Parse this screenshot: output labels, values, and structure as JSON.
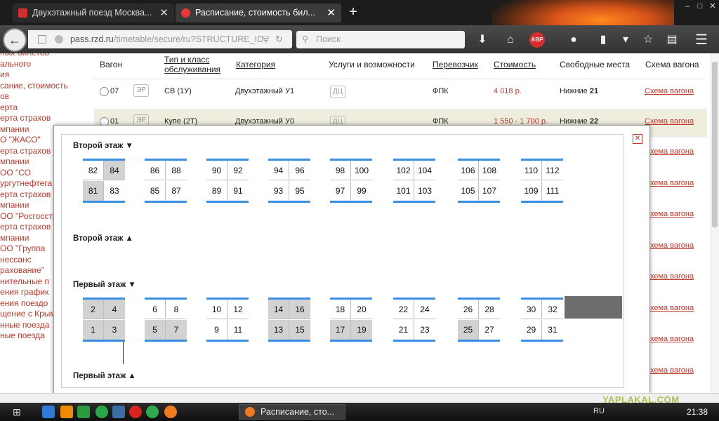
{
  "tabs": [
    {
      "title": "Двухэтажный поезд Москва...",
      "close": "✕"
    },
    {
      "title": "Расписание, стоимость бил...",
      "close": "✕"
    }
  ],
  "new_tab": "+",
  "window": {
    "minimize": "–",
    "maximize": "□",
    "close": "✕"
  },
  "nav": {
    "url_host": "pass.rzd.ru",
    "url_path": "/timetable/secure/ru?STRUCTURE_ID=",
    "search_placeholder": "Поиск",
    "back": "←"
  },
  "left_links": [
    "ных билетов",
    "ального",
    "ия",
    "сание, стоимость",
    "ов",
    "ерта",
    "ерта страхов",
    "мпании",
    "О \"ЖАСО\"",
    "ерта страхов",
    "мпании",
    "ОО \"СО",
    "ургутнефтега",
    "ерта страхов",
    "мпании",
    "ОО \"Росгосстр",
    "ерта страхов",
    "мпании",
    "ОО \"Группа",
    "нессанс",
    "рахование\"",
    "нительные п",
    "ения график",
    "ения поездо",
    "щение с Крым",
    "нные поезда",
    "ные поезда"
  ],
  "table": {
    "headers": {
      "wagon": "Вагон",
      "type": "Тип и класс обслуживания",
      "category": "Категория",
      "services": "Услуги и возможности",
      "carrier": "Перевозчик",
      "cost": "Стоимость",
      "free": "Свободные места",
      "scheme": "Схема вагона"
    },
    "rows": [
      {
        "num": "07",
        "badge": "ЭР",
        "type": "СВ (1У)",
        "category": "Двухэтажный У1",
        "badge2": "ДЦ",
        "carrier": "ФПК",
        "cost": "4 018 р.",
        "free_label": "Нижние",
        "free_count": "21",
        "scheme": "Схема вагона"
      },
      {
        "num": "01",
        "badge": "ЭР",
        "type": "Купе (2Т)",
        "category": "Двухэтажный У0",
        "badge2": "ДЦ",
        "carrier": "ФПК",
        "cost": "1 550 - 1 700 р.",
        "free_label": "Нижние",
        "free_count": "22",
        "scheme": "Схема вагона"
      }
    ],
    "scheme_links": [
      "Схема вагона",
      "Схема вагона",
      "Схема вагона",
      "Схема вагона",
      "Схема вагона",
      "Схема вагона",
      "Схема вагона",
      "Схема вагона",
      "Схема вагона"
    ]
  },
  "modal": {
    "close": "✕",
    "floor_labels": [
      "Второй этаж ▼",
      "Второй этаж ▲",
      "Первый этаж ▼",
      "Первый этаж ▲"
    ],
    "upper_compartments": [
      [
        {
          "n": "82",
          "occ": false
        },
        {
          "n": "84",
          "occ": true
        },
        {
          "n": "81",
          "occ": true
        },
        {
          "n": "83",
          "occ": false
        }
      ],
      [
        {
          "n": "86",
          "occ": false
        },
        {
          "n": "88",
          "occ": false
        },
        {
          "n": "85",
          "occ": false
        },
        {
          "n": "87",
          "occ": false
        }
      ],
      [
        {
          "n": "90",
          "occ": false
        },
        {
          "n": "92",
          "occ": false
        },
        {
          "n": "89",
          "occ": false
        },
        {
          "n": "91",
          "occ": false
        }
      ],
      [
        {
          "n": "94",
          "occ": false
        },
        {
          "n": "96",
          "occ": false
        },
        {
          "n": "93",
          "occ": false
        },
        {
          "n": "95",
          "occ": false
        }
      ],
      [
        {
          "n": "98",
          "occ": false
        },
        {
          "n": "100",
          "occ": false
        },
        {
          "n": "97",
          "occ": false
        },
        {
          "n": "99",
          "occ": false
        }
      ],
      [
        {
          "n": "102",
          "occ": false
        },
        {
          "n": "104",
          "occ": false
        },
        {
          "n": "101",
          "occ": false
        },
        {
          "n": "103",
          "occ": false
        }
      ],
      [
        {
          "n": "106",
          "occ": false
        },
        {
          "n": "108",
          "occ": false
        },
        {
          "n": "105",
          "occ": false
        },
        {
          "n": "107",
          "occ": false
        }
      ],
      [
        {
          "n": "110",
          "occ": false
        },
        {
          "n": "112",
          "occ": false
        },
        {
          "n": "109",
          "occ": false
        },
        {
          "n": "111",
          "occ": false
        }
      ]
    ],
    "lower_compartments": [
      [
        {
          "n": "2",
          "occ": true
        },
        {
          "n": "4",
          "occ": true
        },
        {
          "n": "1",
          "occ": true
        },
        {
          "n": "3",
          "occ": true
        }
      ],
      [
        {
          "n": "6",
          "occ": false
        },
        {
          "n": "8",
          "occ": false
        },
        {
          "n": "5",
          "occ": true
        },
        {
          "n": "7",
          "occ": true
        }
      ],
      [
        {
          "n": "10",
          "occ": false
        },
        {
          "n": "12",
          "occ": false
        },
        {
          "n": "9",
          "occ": false
        },
        {
          "n": "11",
          "occ": false
        }
      ],
      [
        {
          "n": "14",
          "occ": true
        },
        {
          "n": "16",
          "occ": true
        },
        {
          "n": "13",
          "occ": true
        },
        {
          "n": "15",
          "occ": true
        }
      ],
      [
        {
          "n": "18",
          "occ": false
        },
        {
          "n": "20",
          "occ": false
        },
        {
          "n": "17",
          "occ": true
        },
        {
          "n": "19",
          "occ": true
        }
      ],
      [
        {
          "n": "22",
          "occ": false
        },
        {
          "n": "24",
          "occ": false
        },
        {
          "n": "21",
          "occ": false
        },
        {
          "n": "23",
          "occ": false
        }
      ],
      [
        {
          "n": "26",
          "occ": false
        },
        {
          "n": "28",
          "occ": false
        },
        {
          "n": "25",
          "occ": true
        },
        {
          "n": "27",
          "occ": false
        }
      ],
      [
        {
          "n": "30",
          "occ": false
        },
        {
          "n": "32",
          "occ": false
        },
        {
          "n": "29",
          "occ": false
        },
        {
          "n": "31",
          "occ": false
        }
      ]
    ]
  },
  "taskbar": {
    "task_title": "Расписание, сто...",
    "lang": "RU",
    "clock": "21:38"
  },
  "watermark": "YAPLAKAL.COM",
  "colors": {
    "accent_red": "#c0392b",
    "seat_border_blue": "#3a8ee0",
    "occupied": "#d2d2d2"
  },
  "icons": [
    "back-arrow-icon",
    "page-icon",
    "globe-icon",
    "dropdown-icon",
    "reload-icon",
    "search-icon",
    "download-icon",
    "home-icon",
    "adblock-icon",
    "user-icon",
    "battery-icon",
    "star-icon",
    "clipboard-icon",
    "menu-icon",
    "start-icon",
    "firefox-icon",
    "opera-icon"
  ]
}
